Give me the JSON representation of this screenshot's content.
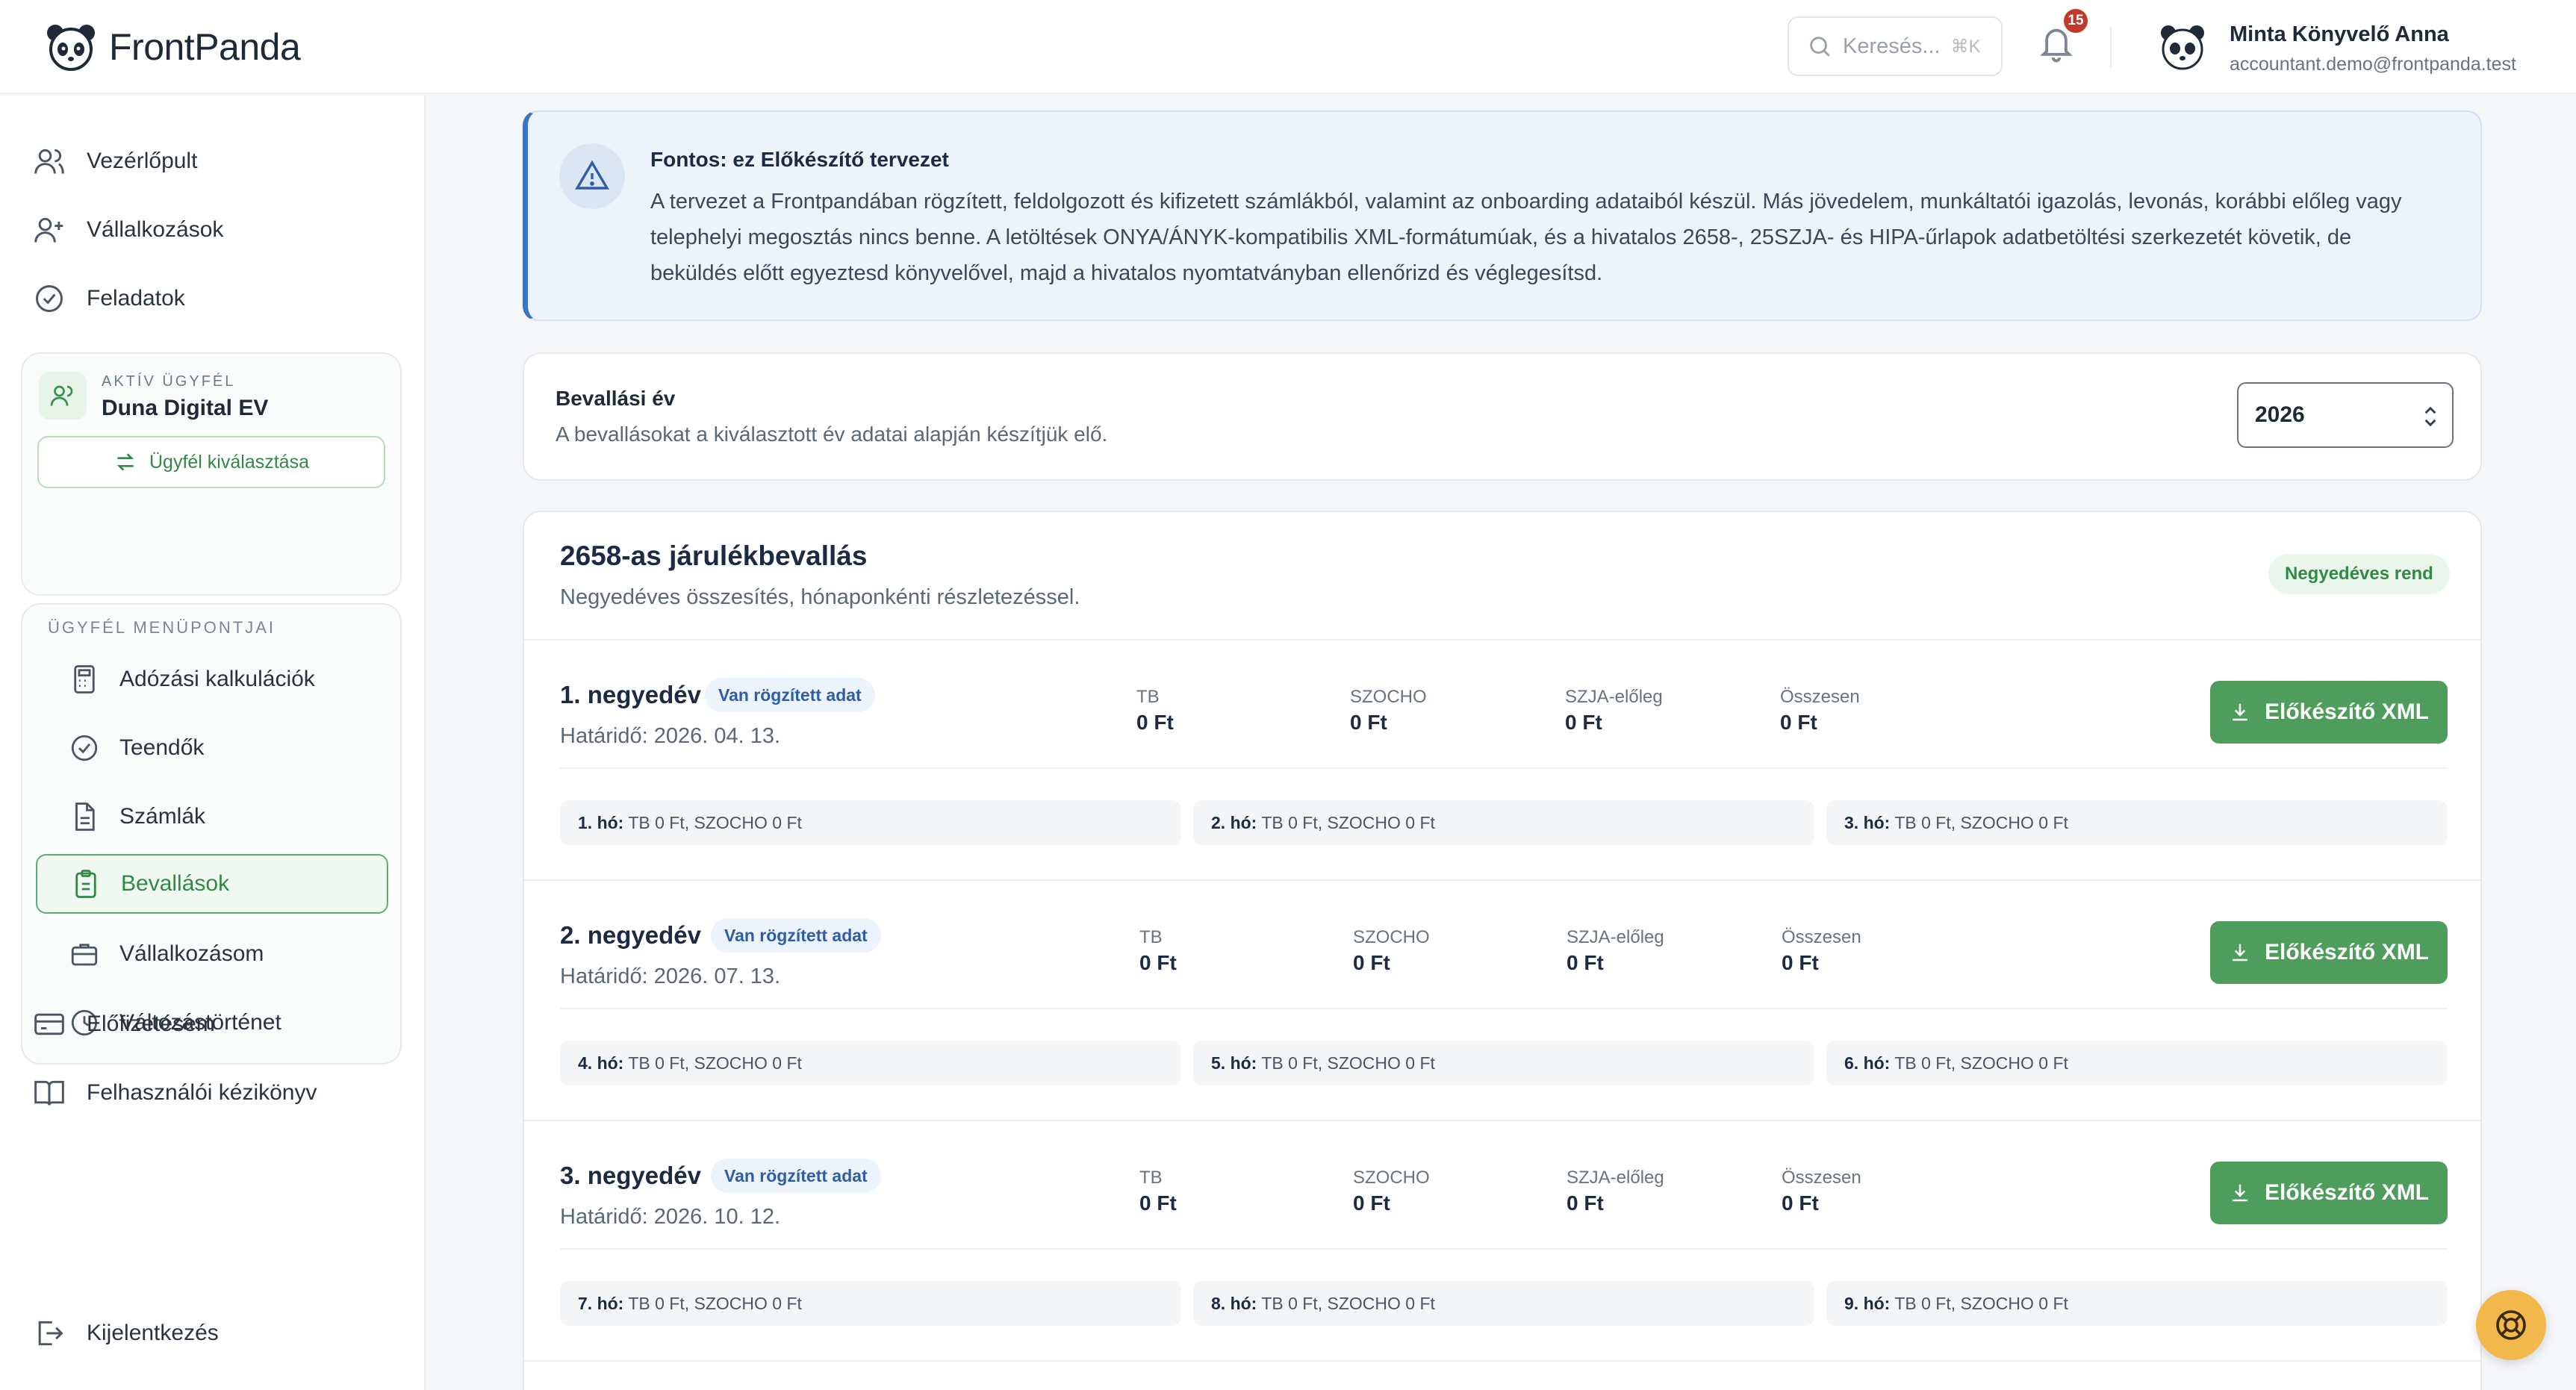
{
  "app": {
    "brand": "FrontPanda",
    "search_placeholder": "Keresés...",
    "search_shortcut": "⌘K",
    "notifications_count": "15",
    "user": {
      "name": "Minta Könyvelő Anna",
      "email": "accountant.demo@frontpanda.test"
    }
  },
  "sidebar": {
    "top_items": [
      {
        "label": "Vezérlőpult",
        "icon": "users-icon"
      },
      {
        "label": "Vállalkozások",
        "icon": "user-plus-icon"
      },
      {
        "label": "Feladatok",
        "icon": "check-circle-icon"
      }
    ],
    "active_client": {
      "caption": "AKTÍV ÜGYFÉL",
      "name": "Duna Digital EV",
      "select_label": "Ügyfél kiválasztása"
    },
    "client_menu": {
      "caption": "ÜGYFÉL MENÜPONTJAI",
      "items": [
        {
          "label": "Adózási kalkulációk",
          "icon": "calculator-icon",
          "active": false
        },
        {
          "label": "Teendők",
          "icon": "check-circle-icon",
          "active": false
        },
        {
          "label": "Számlák",
          "icon": "document-icon",
          "active": false
        },
        {
          "label": "Bevallások",
          "icon": "clipboard-icon",
          "active": true
        },
        {
          "label": "Vállalkozásom",
          "icon": "briefcase-icon",
          "active": false
        },
        {
          "label": "Változástörténet",
          "icon": "clock-icon",
          "active": false
        }
      ]
    },
    "bottom_items": [
      {
        "label": "Előfizetésem",
        "icon": "credit-card-icon"
      },
      {
        "label": "Felhasználói kézikönyv",
        "icon": "book-icon"
      }
    ],
    "logout_label": "Kijelentkezés"
  },
  "notice": {
    "title": "Fontos: ez Előkészítő tervezet",
    "body": "A tervezet a Frontpandában rögzített, feldolgozott és kifizetett számlákból, valamint az onboarding adataiból készül. Más jövedelem, munkáltatói igazolás, levonás, korábbi előleg vagy telephelyi megosztás nincs benne. A letöltések ONYA/ÁNYK-kompatibilis XML-formátumúak, és a hivatalos 2658-, 25SZJA- és HIPA-űrlapok adatbetöltési szerkezetét követik, de beküldés előtt egyeztesd könyvelővel, majd a hivatalos nyomtatványban ellenőrizd és véglegesítsd."
  },
  "year_selector": {
    "title": "Bevallási év",
    "subtitle": "A bevallásokat a kiválasztott év adatai alapján készítjük elő.",
    "value": "2026"
  },
  "declaration": {
    "title": "2658-as járulékbevallás",
    "subtitle": "Negyedéves összesítés, hónaponkénti részletezéssel.",
    "badge": "Negyedéves rend",
    "column_labels": {
      "tb": "TB",
      "szocho": "SZOCHO",
      "szja": "SZJA-előleg",
      "total": "Összesen"
    },
    "button_label": "Előkészítő XML",
    "quarters": [
      {
        "title": "1. negyedév",
        "tag": "Van rögzített adat",
        "deadline": "Határidő: 2026. 04. 13.",
        "tb": "0 Ft",
        "szocho": "0 Ft",
        "szja": "0 Ft",
        "total": "0 Ft",
        "months": [
          {
            "label": "1. hó:",
            "text": "TB 0 Ft, SZOCHO 0 Ft"
          },
          {
            "label": "2. hó:",
            "text": "TB 0 Ft, SZOCHO 0 Ft"
          },
          {
            "label": "3. hó:",
            "text": "TB 0 Ft, SZOCHO 0 Ft"
          }
        ]
      },
      {
        "title": "2. negyedév",
        "tag": "Van rögzített adat",
        "deadline": "Határidő: 2026. 07. 13.",
        "tb": "0 Ft",
        "szocho": "0 Ft",
        "szja": "0 Ft",
        "total": "0 Ft",
        "months": [
          {
            "label": "4. hó:",
            "text": "TB 0 Ft, SZOCHO 0 Ft"
          },
          {
            "label": "5. hó:",
            "text": "TB 0 Ft, SZOCHO 0 Ft"
          },
          {
            "label": "6. hó:",
            "text": "TB 0 Ft, SZOCHO 0 Ft"
          }
        ]
      },
      {
        "title": "3. negyedév",
        "tag": "Van rögzített adat",
        "deadline": "Határidő: 2026. 10. 12.",
        "tb": "0 Ft",
        "szocho": "0 Ft",
        "szja": "0 Ft",
        "total": "0 Ft",
        "months": [
          {
            "label": "7. hó:",
            "text": "TB 0 Ft, SZOCHO 0 Ft"
          },
          {
            "label": "8. hó:",
            "text": "TB 0 Ft, SZOCHO 0 Ft"
          },
          {
            "label": "9. hó:",
            "text": "TB 0 Ft, SZOCHO 0 Ft"
          }
        ]
      }
    ]
  },
  "colors": {
    "accent_green": "#4f9d5c",
    "notice_blue": "#3b74c4",
    "badge_red": "#c0392b",
    "help_yellow": "#f2b84b"
  }
}
